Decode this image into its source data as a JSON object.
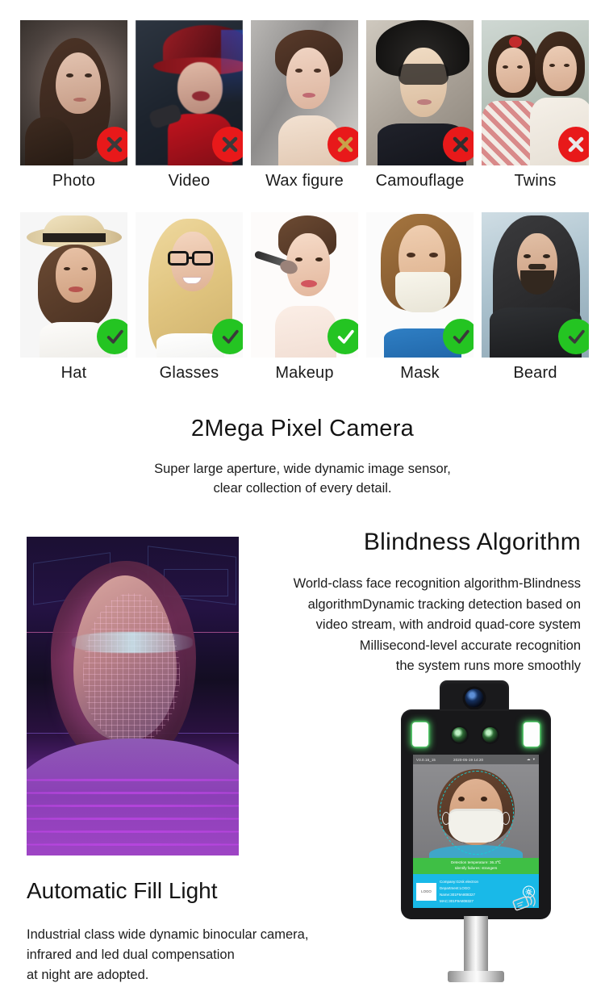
{
  "antispoof_row": {
    "status": "deny",
    "badge_icon": "cross-icon",
    "items": [
      {
        "label": "Photo"
      },
      {
        "label": "Video"
      },
      {
        "label": "Wax figure"
      },
      {
        "label": "Camouflage"
      },
      {
        "label": "Twins"
      }
    ]
  },
  "accept_row": {
    "status": "allow",
    "badge_icon": "check-icon",
    "items": [
      {
        "label": "Hat"
      },
      {
        "label": "Glasses"
      },
      {
        "label": "Makeup"
      },
      {
        "label": "Mask"
      },
      {
        "label": "Beard"
      }
    ]
  },
  "camera_section": {
    "title": "2Mega Pixel Camera",
    "line1": "Super large aperture, wide dynamic image sensor,",
    "line2": "clear collection of every detail."
  },
  "algorithm_section": {
    "title": "Blindness Algorithm",
    "line1": "World-class face recognition algorithm-Blindness",
    "line2": "algorithmDynamic tracking detection based on",
    "line3": "video stream, with android quad-core system",
    "line4": "Millisecond-level accurate recognition",
    "line5": "the system runs more smoothly"
  },
  "fill_light_section": {
    "title": "Automatic Fill Light",
    "line1": "Industrial class wide dynamic binocular camera,",
    "line2": "infrared and led dual compensation",
    "line3": "at night are adopted."
  },
  "device": {
    "status_bar": {
      "version": "V3.0.16_15",
      "timestamp": "2020-05-19 14:20",
      "icons": "☁ ▾"
    },
    "temperature_panel": {
      "line1": "Detection temperature: 36.3℃",
      "line2": "Identify failures: strangers"
    },
    "info_panel": {
      "logo_label": "LOGO",
      "line1": "Company:Gzsk electron",
      "line2": "Department:LOGO",
      "line3": "Name:301F9A808327",
      "line4": "MAC:301F9A808327",
      "gear_icon": "gear-icon"
    },
    "rfid_icon": "rfid-card-icon",
    "camera_icon": "camera-lens-icon",
    "led_left_icon": "fill-light-led-icon",
    "led_right_icon": "fill-light-led-icon",
    "ir_left_icon": "infrared-sensor-icon",
    "ir_right_icon": "infrared-sensor-icon"
  },
  "colors": {
    "deny": "#e8191a",
    "allow": "#24c422",
    "temp_green": "#3fbf45",
    "info_blue": "#19b9e8",
    "detect_cyan": "#16cfd6"
  }
}
